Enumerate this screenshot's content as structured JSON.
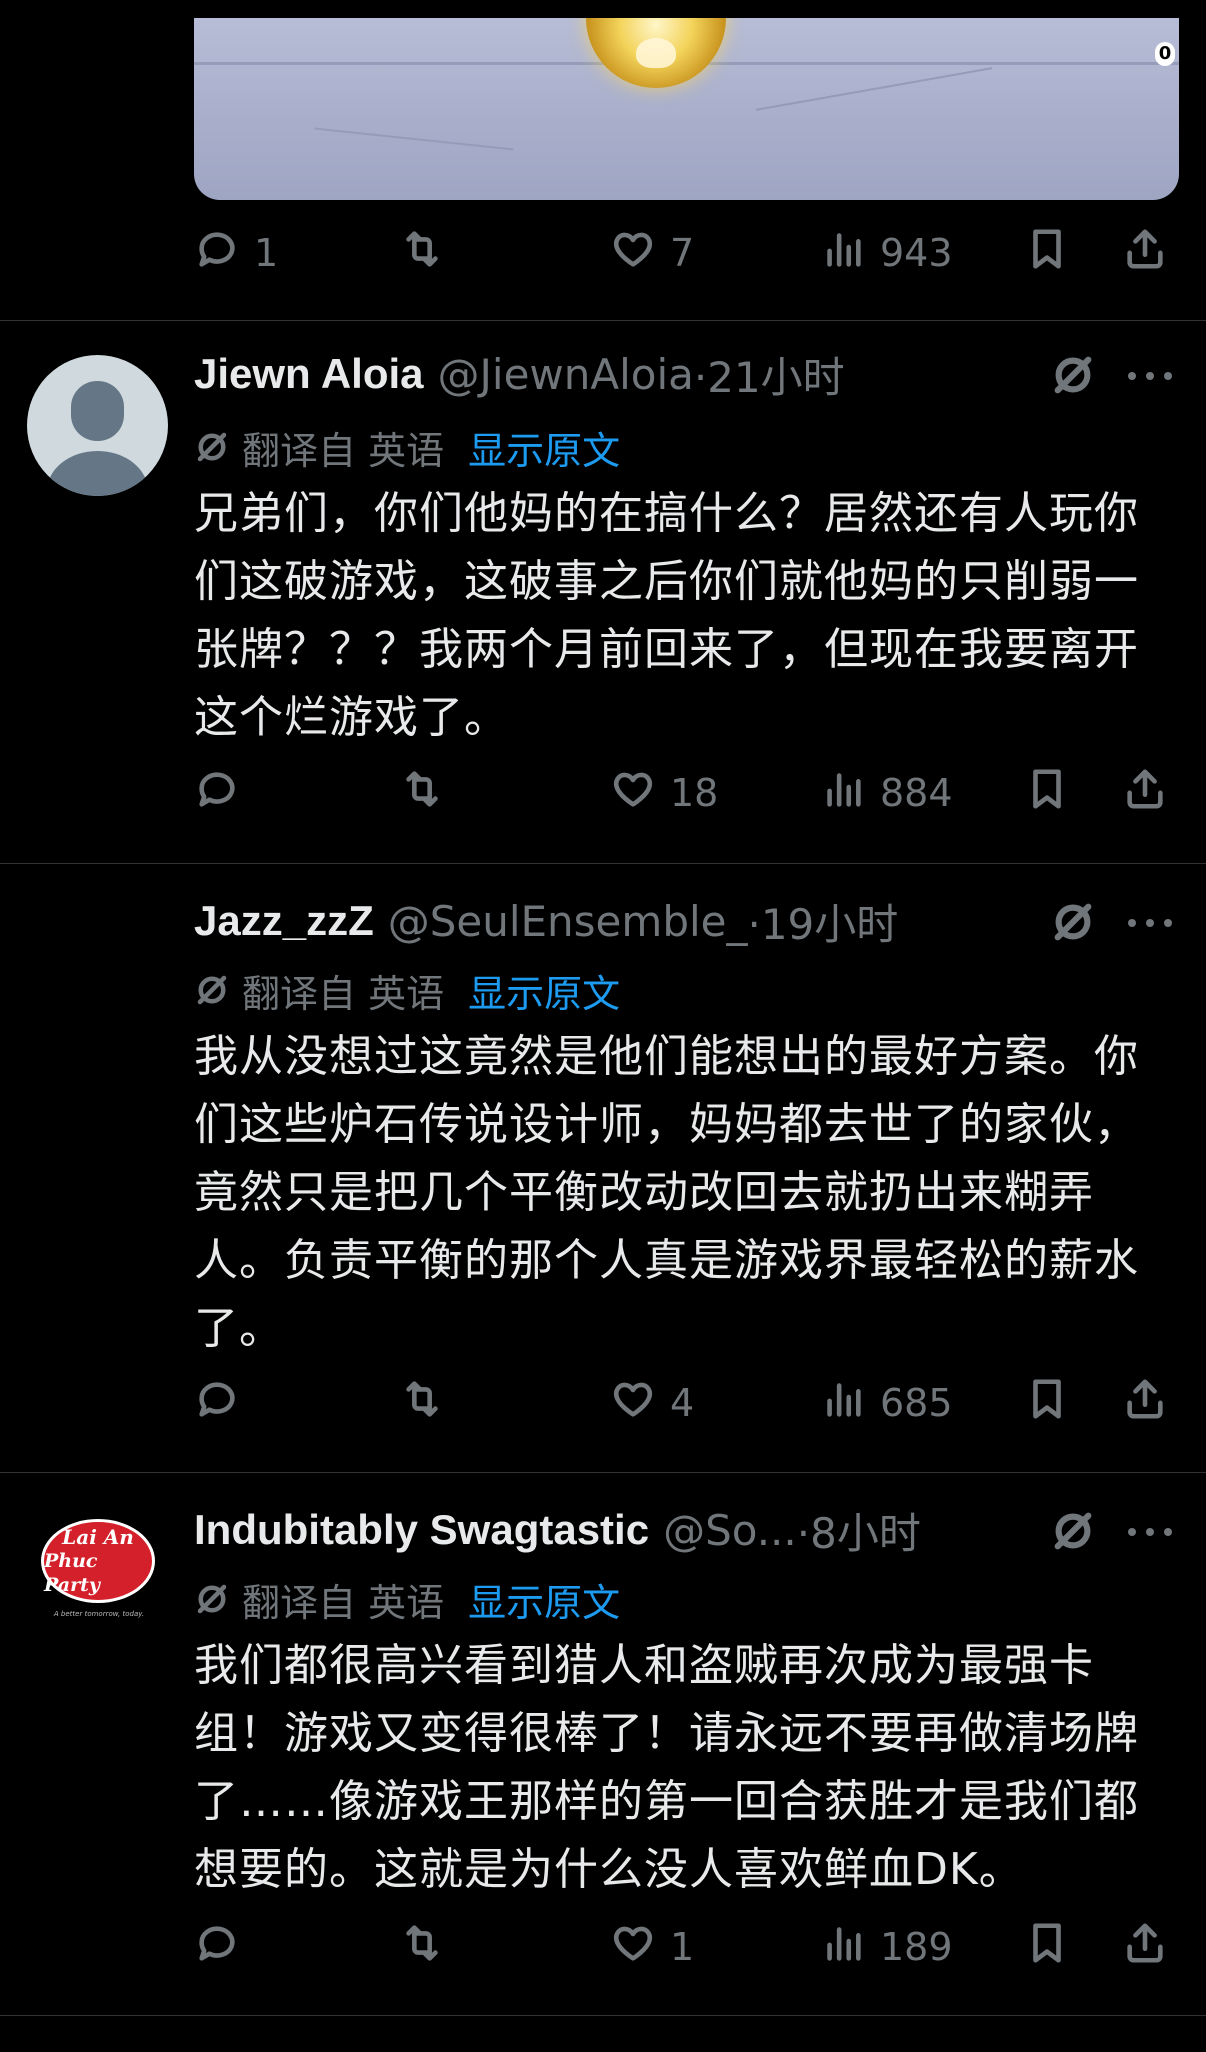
{
  "media": {
    "badge": "0"
  },
  "first_actions": {
    "replies": "1",
    "retweets": "",
    "likes": "7",
    "views": "943"
  },
  "tweets": [
    {
      "name": "Jiewn Aloia",
      "handle": "@JiewnAloia",
      "time": "·21小时",
      "avatar": "default-avatar",
      "translated_label": "翻译自 英语",
      "show_original": "显示原文",
      "text": "兄弟们，你们他妈的在搞什么？居然还有人玩你们这破游戏，这破事之后你们就他妈的只削弱一张牌？？？我两个月前回来了，但现在我要离开这个烂游戏了。",
      "replies": "",
      "retweets": "",
      "likes": "18",
      "views": "884"
    },
    {
      "name": "Jazz_zzZ",
      "handle": "@SeulEnsemble_",
      "time": "·19小时",
      "avatar": "dark-avatar",
      "translated_label": "翻译自 英语",
      "show_original": "显示原文",
      "text": "我从没想过这竟然是他们能想出的最好方案。你们这些炉石传说设计师，妈妈都去世了的家伙，竟然只是把几个平衡改动改回去就扔出来糊弄人。负责平衡的那个人真是游戏界最轻松的薪水了。",
      "replies": "",
      "retweets": "",
      "likes": "4",
      "views": "685"
    },
    {
      "name": "Indubitably Swagtastic",
      "handle": "@So...",
      "time": "·8小时",
      "avatar": "logo-avatar",
      "avatar_text_1": "Lai An",
      "avatar_text_2": "Phuc Party",
      "avatar_tagline": "A better tomorrow, today.",
      "translated_label": "翻译自 英语",
      "show_original": "显示原文",
      "text": "我们都很高兴看到猎人和盗贼再次成为最强卡组！游戏又变得很棒了！请永远不要再做清场牌了……像游戏王那样的第一回合获胜才是我们都想要的。这就是为什么没人喜欢鲜血DK。",
      "replies": "",
      "retweets": "",
      "likes": "1",
      "views": "189"
    }
  ],
  "colors": {
    "background": "#000000",
    "text": "#e7e9ea",
    "muted": "#71767b",
    "link": "#1d9bf0",
    "divider": "#2f3336"
  }
}
